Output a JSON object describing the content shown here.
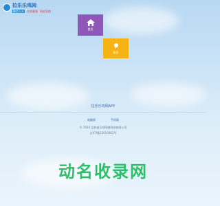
{
  "logo": {
    "title": "拉乐乐鸡网",
    "tags": [
      "微信公众",
      "在线客服",
      "网站导航"
    ]
  },
  "tiles": [
    {
      "label": "首页",
      "icon": "home-icon"
    },
    {
      "label": "联系",
      "icon": "contact-icon"
    }
  ],
  "footer": {
    "title": "拉乐乐鸡网APP",
    "links": [
      "电脑版",
      "手机版"
    ],
    "copyright": "© 2014 吉林省乐鸡网络科技有限公司",
    "icp": "吉ICP备13010002号"
  },
  "watermark": "动名收录网",
  "colors": {
    "home_tile": "#8f58b8",
    "contact_tile": "#f5b314",
    "watermark": "#2fbf6a"
  }
}
